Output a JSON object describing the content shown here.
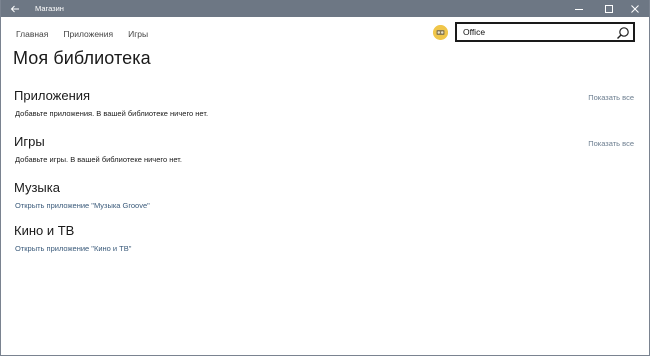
{
  "window": {
    "title": "Магазин"
  },
  "nav": {
    "items": [
      "Главная",
      "Приложения",
      "Игры"
    ]
  },
  "search": {
    "value": "Office"
  },
  "page": {
    "title": "Моя библиотека"
  },
  "sections": [
    {
      "title": "Приложения",
      "text": "Добавьте приложения. В вашей библиотеке ничего нет.",
      "show_all": "Показать все"
    },
    {
      "title": "Игры",
      "text": "Добавьте игры. В вашей библиотеке ничего нет.",
      "show_all": "Показать все"
    },
    {
      "title": "Музыка",
      "link": "Открыть приложение \"Музыка Groove\""
    },
    {
      "title": "Кино и ТВ",
      "link": "Открыть приложение \"Кино и ТВ\""
    }
  ],
  "colors": {
    "titlebar": "#6d7784",
    "link": "#3a5a7a",
    "show_all": "#6b7d8f"
  },
  "icons": {
    "back": "back-arrow-icon",
    "minimize": "minimize-icon",
    "maximize": "maximize-icon",
    "close": "close-icon",
    "search": "search-icon",
    "avatar": "user-avatar"
  }
}
